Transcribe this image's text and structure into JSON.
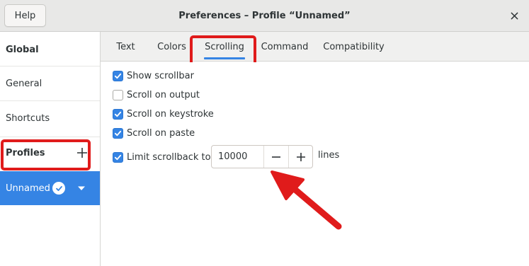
{
  "window": {
    "help_label": "Help",
    "title": "Preferences – Profile “Unnamed”",
    "close_icon": "close-icon"
  },
  "sidebar": {
    "global_heading": "Global",
    "items": [
      {
        "label": "General"
      },
      {
        "label": "Shortcuts"
      }
    ],
    "profiles_heading": "Profiles",
    "add_icon": "plus-icon",
    "profile": {
      "label": "Unnamed",
      "default_icon": "checkmark-circle-icon",
      "menu_icon": "caret-down-icon"
    }
  },
  "tabs": [
    {
      "label": "Text",
      "active": false
    },
    {
      "label": "Colors",
      "active": false
    },
    {
      "label": "Scrolling",
      "active": true
    },
    {
      "label": "Command",
      "active": false
    },
    {
      "label": "Compatibility",
      "active": false
    }
  ],
  "scrolling": {
    "options": [
      {
        "label": "Show scrollbar",
        "checked": true
      },
      {
        "label": "Scroll on output",
        "checked": false
      },
      {
        "label": "Scroll on keystroke",
        "checked": true
      },
      {
        "label": "Scroll on paste",
        "checked": true
      },
      {
        "label": "Limit scrollback to:",
        "checked": true
      }
    ],
    "scrollback_value": "10000",
    "scrollback_unit": "lines",
    "decrement_icon": "minus-icon",
    "increment_icon": "plus-icon"
  },
  "colors": {
    "accent": "#3584e4",
    "annotation": "#e01b1b"
  }
}
